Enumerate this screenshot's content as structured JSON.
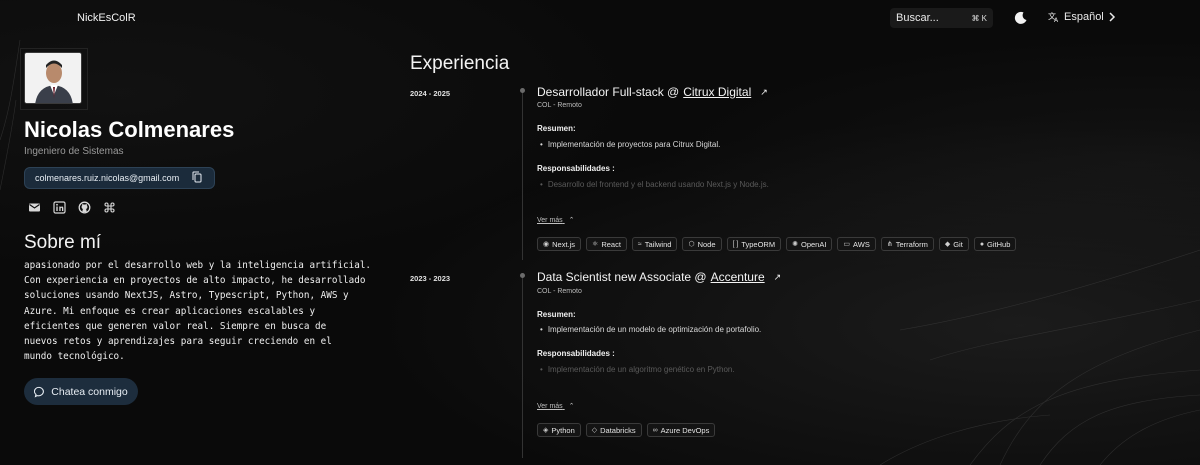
{
  "header": {
    "brand": "NickEsColR",
    "search_label": "Buscar...",
    "search_kbd": "⌘ K",
    "language": "Español"
  },
  "profile": {
    "name": "Nicolas Colmenares",
    "role": "Ingeniero de Sistemas",
    "email": "colmenares.ruiz.nicolas@gmail.com",
    "social": [
      "mail-icon",
      "linkedin-icon",
      "github-icon",
      "command-icon"
    ]
  },
  "about": {
    "title": "Sobre mí",
    "lines": [
      "apasionado por el desarrollo web y la inteligencia artificial.",
      "Con experiencia en proyectos de alto impacto, he desarrollado",
      "soluciones usando NextJS, Astro, Typescript, Python, AWS y",
      "Azure. Mi enfoque es crear aplicaciones escalables y",
      "eficientes que generen valor real. Siempre en busca de",
      "nuevos retos y aprendizajes para seguir creciendo en el",
      "mundo tecnológico."
    ],
    "chat_button": "Chatea conmigo"
  },
  "experience": {
    "title": "Experiencia",
    "jobs": [
      {
        "dates": "2024 - 2025",
        "title_prefix": "Desarrollador Full-stack @",
        "company": "Citrux Digital",
        "location": "COL - Remoto",
        "summary_label": "Resumen:",
        "summary": "Implementación de proyectos para Citrux Digital.",
        "resp_label": "Responsabilidades :",
        "resp": "Desarrollo del frontend y el backend usando Next.js y Node.js.",
        "more": "Ver más",
        "tags": [
          "Next.js",
          "React",
          "Tailwind",
          "Node",
          "TypeORM",
          "OpenAI",
          "AWS",
          "Terraform",
          "Git",
          "GitHub"
        ]
      },
      {
        "dates": "2023 - 2023",
        "title_prefix": "Data Scientist new Associate @",
        "company": "Accenture",
        "location": "COL - Remoto",
        "summary_label": "Resumen:",
        "summary": "Implementación de un modelo de optimización de portafolio.",
        "resp_label": "Responsabilidades :",
        "resp": "Implementación de un algoritmo genético en Python.",
        "more": "Ver más",
        "tags": [
          "Python",
          "Databricks",
          "Azure DevOps"
        ]
      }
    ]
  },
  "colors": {
    "background": "#0a0a0a",
    "accent_pill": "#1b2b3b",
    "text": "#e8e8e8"
  }
}
